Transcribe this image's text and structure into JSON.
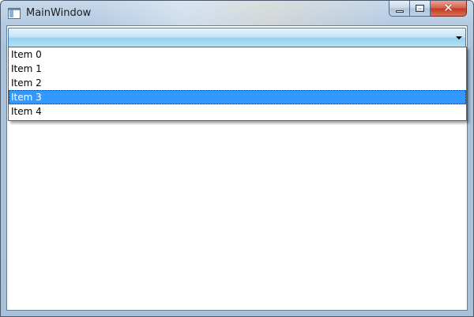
{
  "window": {
    "title": "MainWindow",
    "close_glyph": "✕"
  },
  "combobox": {
    "selected_value": "",
    "items": [
      {
        "label": "Item 0"
      },
      {
        "label": "Item 1"
      },
      {
        "label": "Item 2"
      },
      {
        "label": "Item 3"
      },
      {
        "label": "Item 4"
      }
    ],
    "highlighted_index": 3
  },
  "colors": {
    "highlight": "#3399ff",
    "combo_border": "#3c7fb1",
    "close_button": "#c2381f"
  },
  "icons": {
    "app": "window-app-icon",
    "minimize": "minimize-icon",
    "maximize": "maximize-icon",
    "close": "close-icon",
    "dropdown": "chevron-down-icon"
  }
}
